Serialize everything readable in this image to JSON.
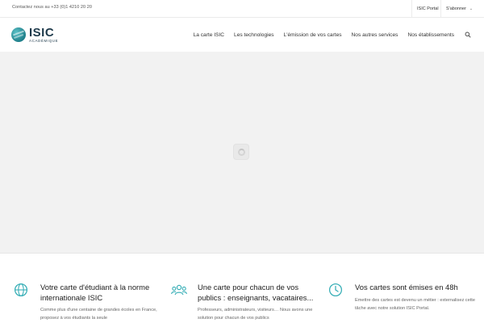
{
  "topbar": {
    "contact": "Contactez nous au +33 (0)1 4210 20 20",
    "portal_link": "ISIC Portal",
    "subscribe_link": "S'abonner",
    "subscribe_chevron": "⌄"
  },
  "header": {
    "logo_main": "ISIC",
    "logo_sub": "ACADÉMIQUE",
    "nav": [
      "La carte ISIC",
      "Les technologies",
      "L'émission de vos cartes",
      "Nos autres services",
      "Nos établissements"
    ],
    "search_icon": "search-icon"
  },
  "hero": {
    "loader_icon": "loading-spinner-icon"
  },
  "features": [
    {
      "icon": "globe-icon",
      "title": "Votre carte d'étudiant à la norme internationale ISIC",
      "text": "Comme plus d'une centaine de grandes écoles en France, proposez à vos étudiants la seule"
    },
    {
      "icon": "users-icon",
      "title": "Une carte pour chacun de vos publics : enseignants, vacataires...",
      "text": "Professeurs, administrateurs, visiteurs… Nous avons une solution pour chacun de vos publics"
    },
    {
      "icon": "clock-icon",
      "title": "Vos cartes sont émises en 48h",
      "text": "Emettre des cartes est devenu un métier : externalisez cette tâche avec notre solution ISIC Portal."
    }
  ],
  "colors": {
    "accent": "#3bb0b8",
    "logo_dark": "#1e3a4b",
    "hero_bg": "#f2f2f2"
  }
}
